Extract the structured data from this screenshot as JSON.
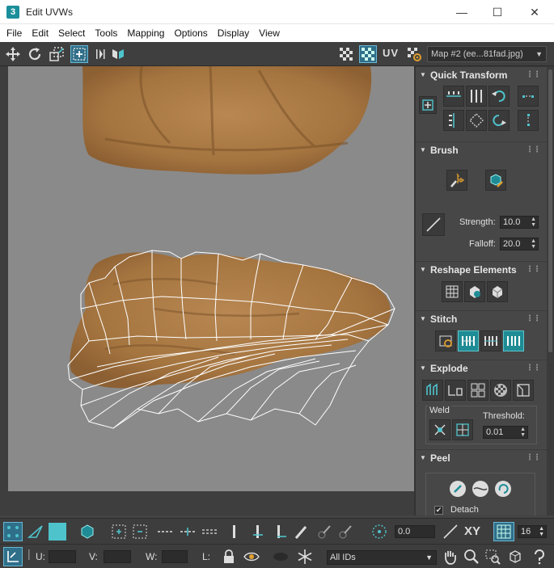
{
  "window": {
    "title": "Edit UVWs",
    "app_icon": "3",
    "controls": {
      "minimize": "—",
      "maximize": "☐",
      "close": "✕"
    }
  },
  "menu": [
    "File",
    "Edit",
    "Select",
    "Tools",
    "Mapping",
    "Options",
    "Display",
    "View"
  ],
  "toolbar": {
    "uv_label": "UV",
    "map_dropdown": "Map #2 (ee...81fad.jpg)"
  },
  "panel": {
    "quick_transform": {
      "title": "Quick Transform"
    },
    "brush": {
      "title": "Brush",
      "strength_label": "Strength:",
      "strength_value": "10.0",
      "falloff_label": "Falloff:",
      "falloff_value": "20.0"
    },
    "reshape": {
      "title": "Reshape Elements"
    },
    "stitch": {
      "title": "Stitch"
    },
    "explode": {
      "title": "Explode",
      "weld_label": "Weld",
      "threshold_label": "Threshold:",
      "threshold_value": "0.01"
    },
    "peel": {
      "title": "Peel",
      "detach_label": "Detach",
      "detach_checked": true
    }
  },
  "bottom": {
    "angle_value": "0.0",
    "xy_label": "XY",
    "grid_value": "16",
    "u_label": "U:",
    "v_label": "V:",
    "w_label": "W:",
    "l_label": "L:",
    "ids_dropdown": "All IDs"
  },
  "colors": {
    "accent": "#1f8c95",
    "highlight": "#69b7d4",
    "panel_bg": "#474747",
    "viewport_bg": "#8a8a8a",
    "cookie": "#a87a45",
    "wire": "#ffffff"
  }
}
